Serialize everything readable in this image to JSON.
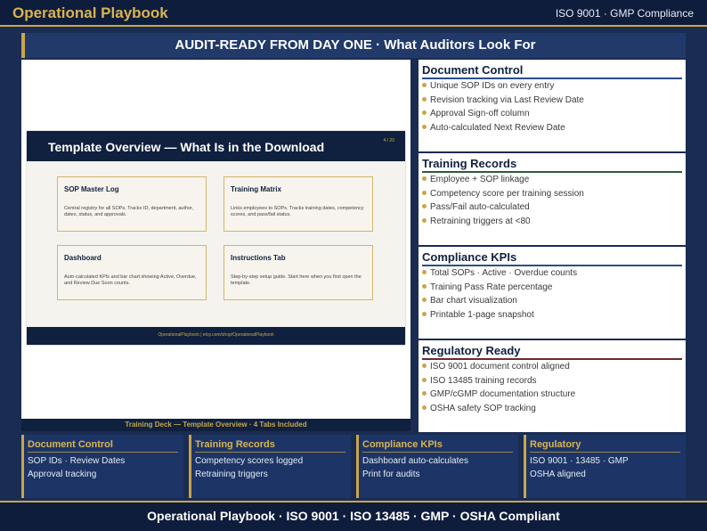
{
  "header": {
    "brand": "Operational Playbook",
    "tagline": "ISO 9001 · GMP Compliance"
  },
  "banner": {
    "text": "AUDIT-READY FROM DAY ONE  ·  What Auditors Look For"
  },
  "preview": {
    "caption": "Training Deck — Template Overview · 4 Tabs Included",
    "slide": {
      "title": "Template Overview — What Is in the Download",
      "page": "4 / 20",
      "cards": [
        {
          "title": "SOP Master Log",
          "desc": "Central registry for all SOPs. Tracks ID, department, author, dates, status, and approvals."
        },
        {
          "title": "Training Matrix",
          "desc": "Links employees to SOPs. Tracks training dates, competency scores, and pass/fail status."
        },
        {
          "title": "Dashboard",
          "desc": "Auto-calculated KPIs and bar chart showing Active, Overdue, and Review Due Soon counts."
        },
        {
          "title": "Instructions Tab",
          "desc": "Step-by-step setup guide. Start here when you first open the template."
        }
      ],
      "footer": "OperationalPlaybook | etsy.com/shop/OperationalPlaybook"
    }
  },
  "panels": [
    {
      "title": "Document Control",
      "accent": "#2a4d8a",
      "items": [
        "Unique SOP IDs on every entry",
        "Revision tracking via Last Review Date",
        "Approval Sign-off column",
        "Auto-calculated Next Review Date"
      ]
    },
    {
      "title": "Training Records",
      "accent": "#2f5a3a",
      "items": [
        "Employee + SOP linkage",
        "Competency score per training session",
        "Pass/Fail auto-calculated",
        "Retraining triggers at <80"
      ]
    },
    {
      "title": "Compliance KPIs",
      "accent": "#2a4d8a",
      "items": [
        "Total SOPs · Active · Overdue counts",
        "Training Pass Rate percentage",
        "Bar chart visualization",
        "Printable 1-page snapshot"
      ]
    },
    {
      "title": "Regulatory Ready",
      "accent": "#6a2a2a",
      "items": [
        "ISO 9001 document control aligned",
        "ISO 13485 training records",
        "GMP/cGMP documentation structure",
        "OSHA safety SOP tracking"
      ]
    }
  ],
  "bottom_cards": [
    {
      "title": "Document Control",
      "lines": [
        "SOP IDs · Review Dates",
        "Approval tracking"
      ]
    },
    {
      "title": "Training Records",
      "lines": [
        "Competency scores logged",
        "Retraining triggers"
      ]
    },
    {
      "title": "Compliance KPIs",
      "lines": [
        "Dashboard auto-calculates",
        "Print for audits"
      ]
    },
    {
      "title": "Regulatory",
      "lines": [
        "ISO 9001 · 13485 · GMP",
        "OSHA aligned"
      ]
    }
  ],
  "footer": {
    "text": "Operational Playbook  ·  ISO 9001  ·  ISO 13485  ·  GMP  ·  OSHA Compliant"
  },
  "colors": {
    "navy": "#1a2c52",
    "gold": "#c9a64a",
    "dark_navy": "#0f1d3c"
  }
}
